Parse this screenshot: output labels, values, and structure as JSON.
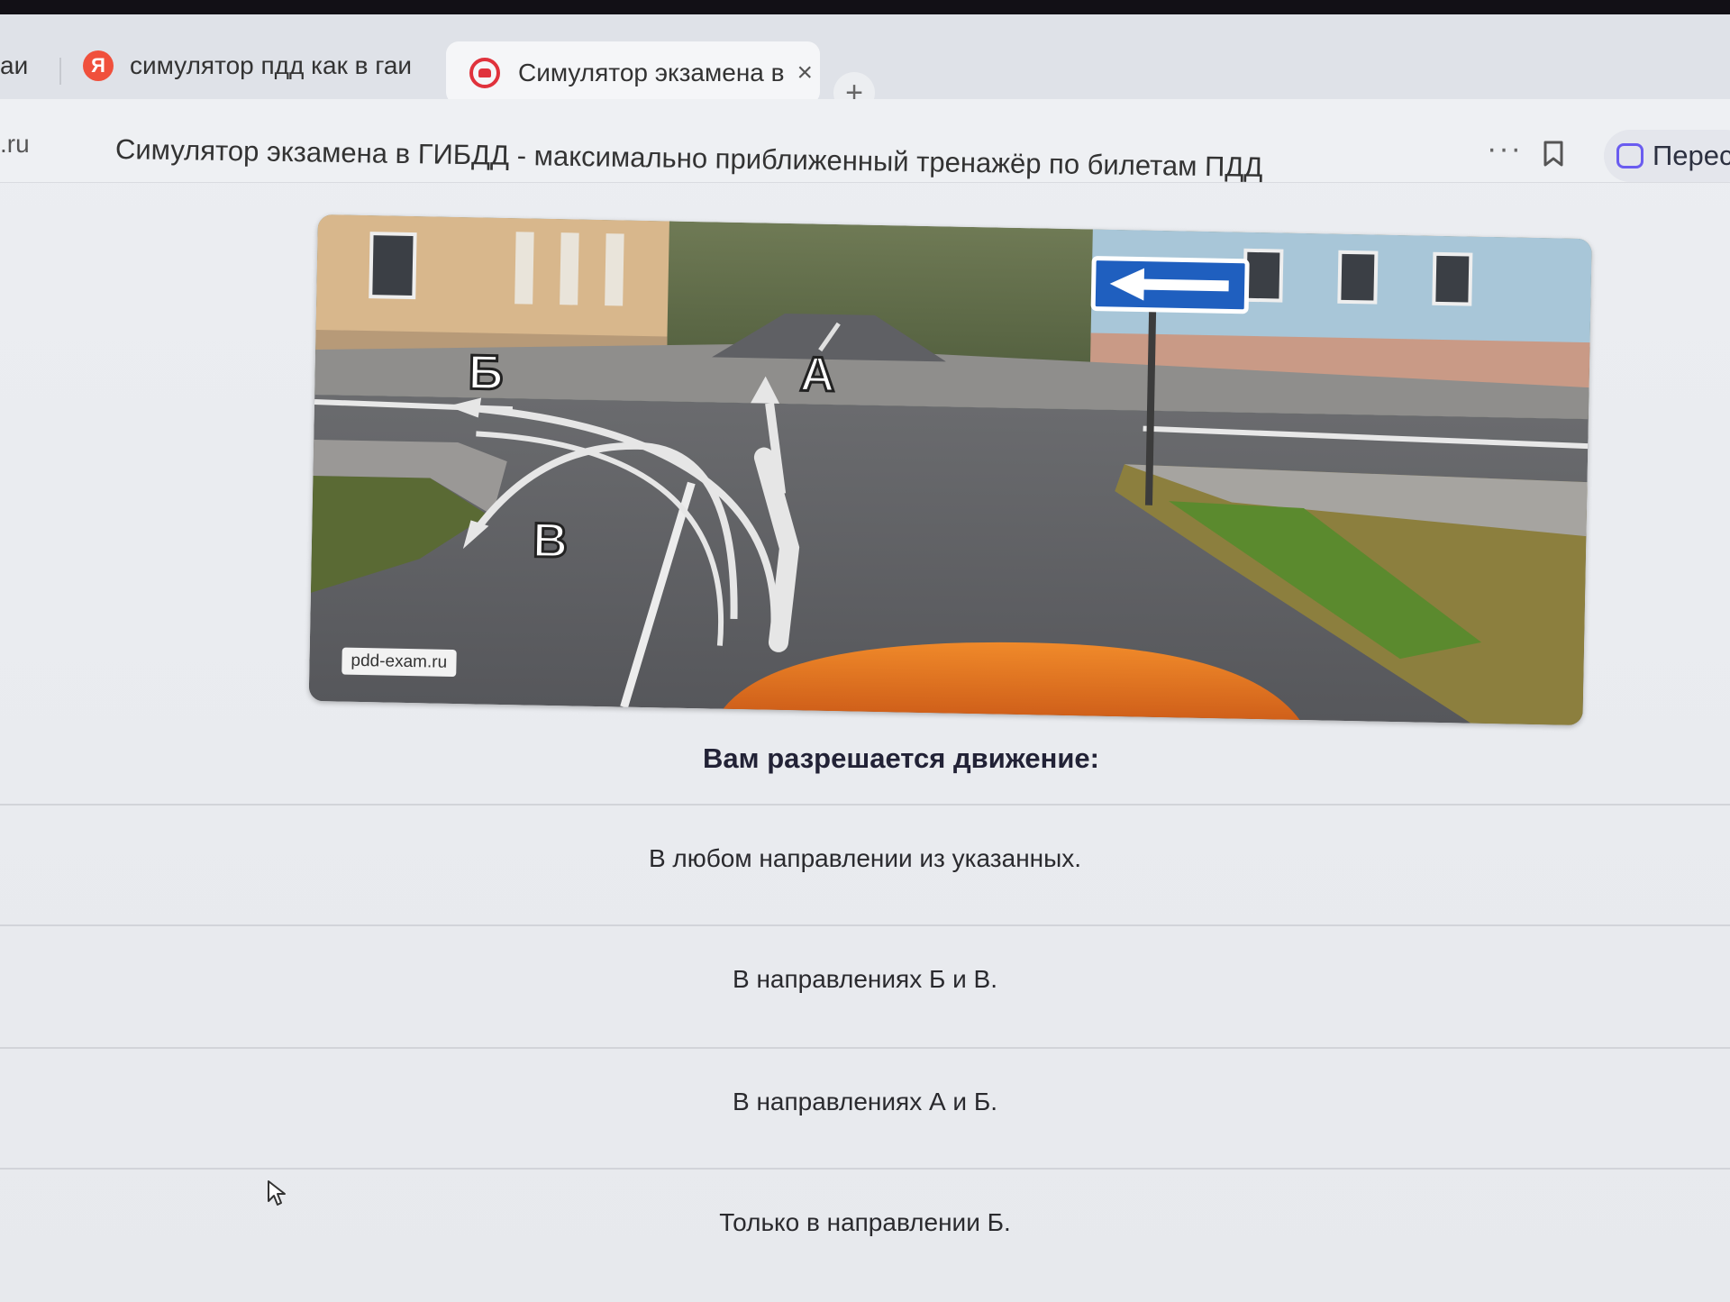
{
  "tabs": [
    {
      "label": "аи",
      "icon": "partial-tab"
    },
    {
      "label": "симулятор пдд как в гаи",
      "icon": "yandex-icon"
    },
    {
      "label": "Симулятор экзамена в",
      "icon": "car-icon",
      "active": true
    }
  ],
  "address_bar": {
    "domain": ".ru",
    "title": "Симулятор экзамена в ГИБДД - максимально приближенный тренажёр по билетам ПДД",
    "translate_label": "Перес"
  },
  "picture": {
    "labels": {
      "a": "А",
      "b": "Б",
      "c": "В"
    },
    "watermark": "pdd-exam.ru"
  },
  "question": "Вам разрешается движение:",
  "answers": [
    "В любом направлении из указанных.",
    "В направлениях Б и В.",
    "В направлениях А и Б.",
    "Только в направлении Б."
  ],
  "colors": {
    "accent_red": "#e0323c",
    "sign_blue": "#1f5fbf",
    "translate_purple": "#6a5cf0"
  }
}
